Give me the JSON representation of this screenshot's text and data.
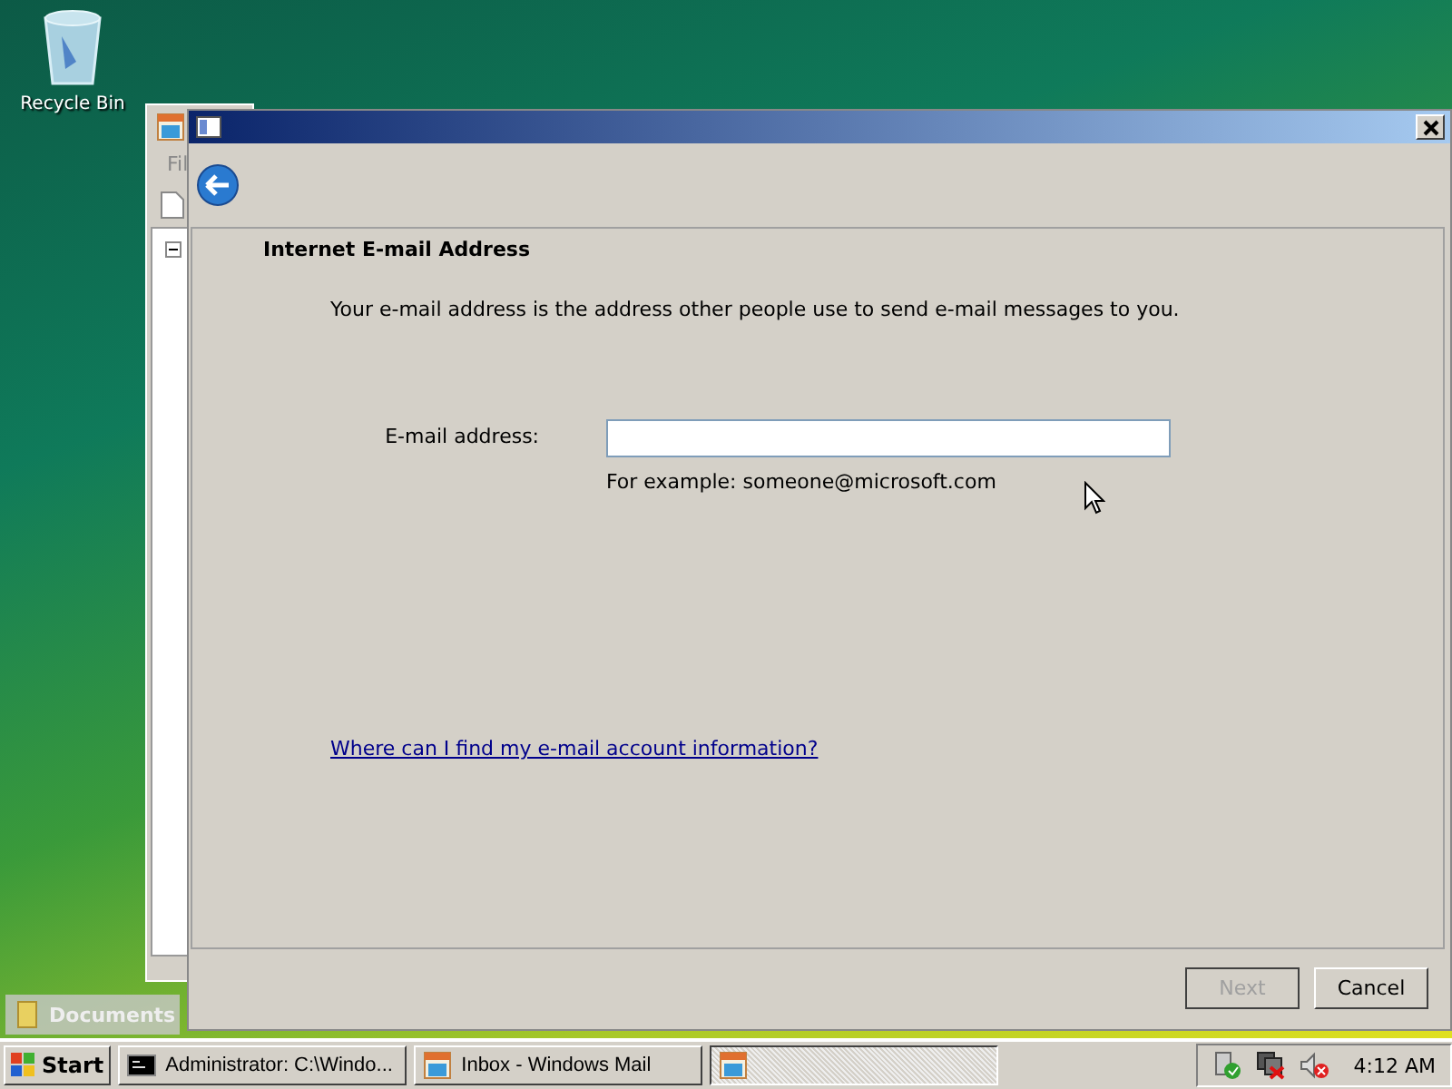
{
  "desktop": {
    "icons": [
      {
        "label": "Recycle Bin"
      }
    ],
    "gadget_label": "Documents"
  },
  "background_window": {
    "menu_text": "Fil"
  },
  "dialog": {
    "heading": "Internet E-mail Address",
    "description": "Your e-mail address is the address other people use to send e-mail messages to you.",
    "field": {
      "label": "E-mail address:",
      "example": "For example: someone@microsoft.com"
    },
    "link": "Where can I find my e-mail account information?",
    "buttons": [
      {
        "label": "Next",
        "disabled": true
      },
      {
        "label": "Cancel",
        "disabled": false
      }
    ]
  },
  "taskbar": {
    "start_label": "Start",
    "tasks": [
      {
        "kind": "console",
        "label": "Administrator: C:\\Windo...",
        "selected": false
      },
      {
        "kind": "mail",
        "label": "Inbox - Windows Mail",
        "selected": false
      },
      {
        "kind": "mail",
        "selected": true
      }
    ],
    "clock": "4:12 AM"
  }
}
